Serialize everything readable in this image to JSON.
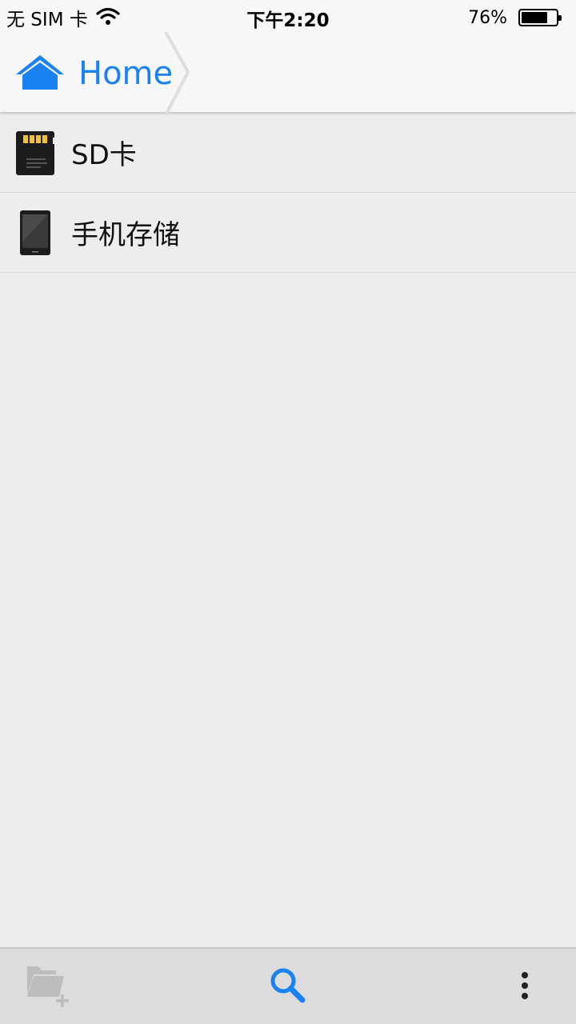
{
  "status_bar": {
    "carrier": "无 SIM 卡",
    "time": "下午2:20",
    "battery_text": "76%",
    "battery_level": 0.76
  },
  "breadcrumb": {
    "home_label": "Home",
    "accent_color": "#1a82f0"
  },
  "storage_list": [
    {
      "label": "SD卡",
      "icon": "sd-card-icon"
    },
    {
      "label": "手机存储",
      "icon": "phone-storage-icon"
    }
  ],
  "toolbar": {
    "new_folder_icon": "new-folder-icon",
    "search_icon": "search-icon",
    "more_icon": "more-vertical-icon"
  }
}
